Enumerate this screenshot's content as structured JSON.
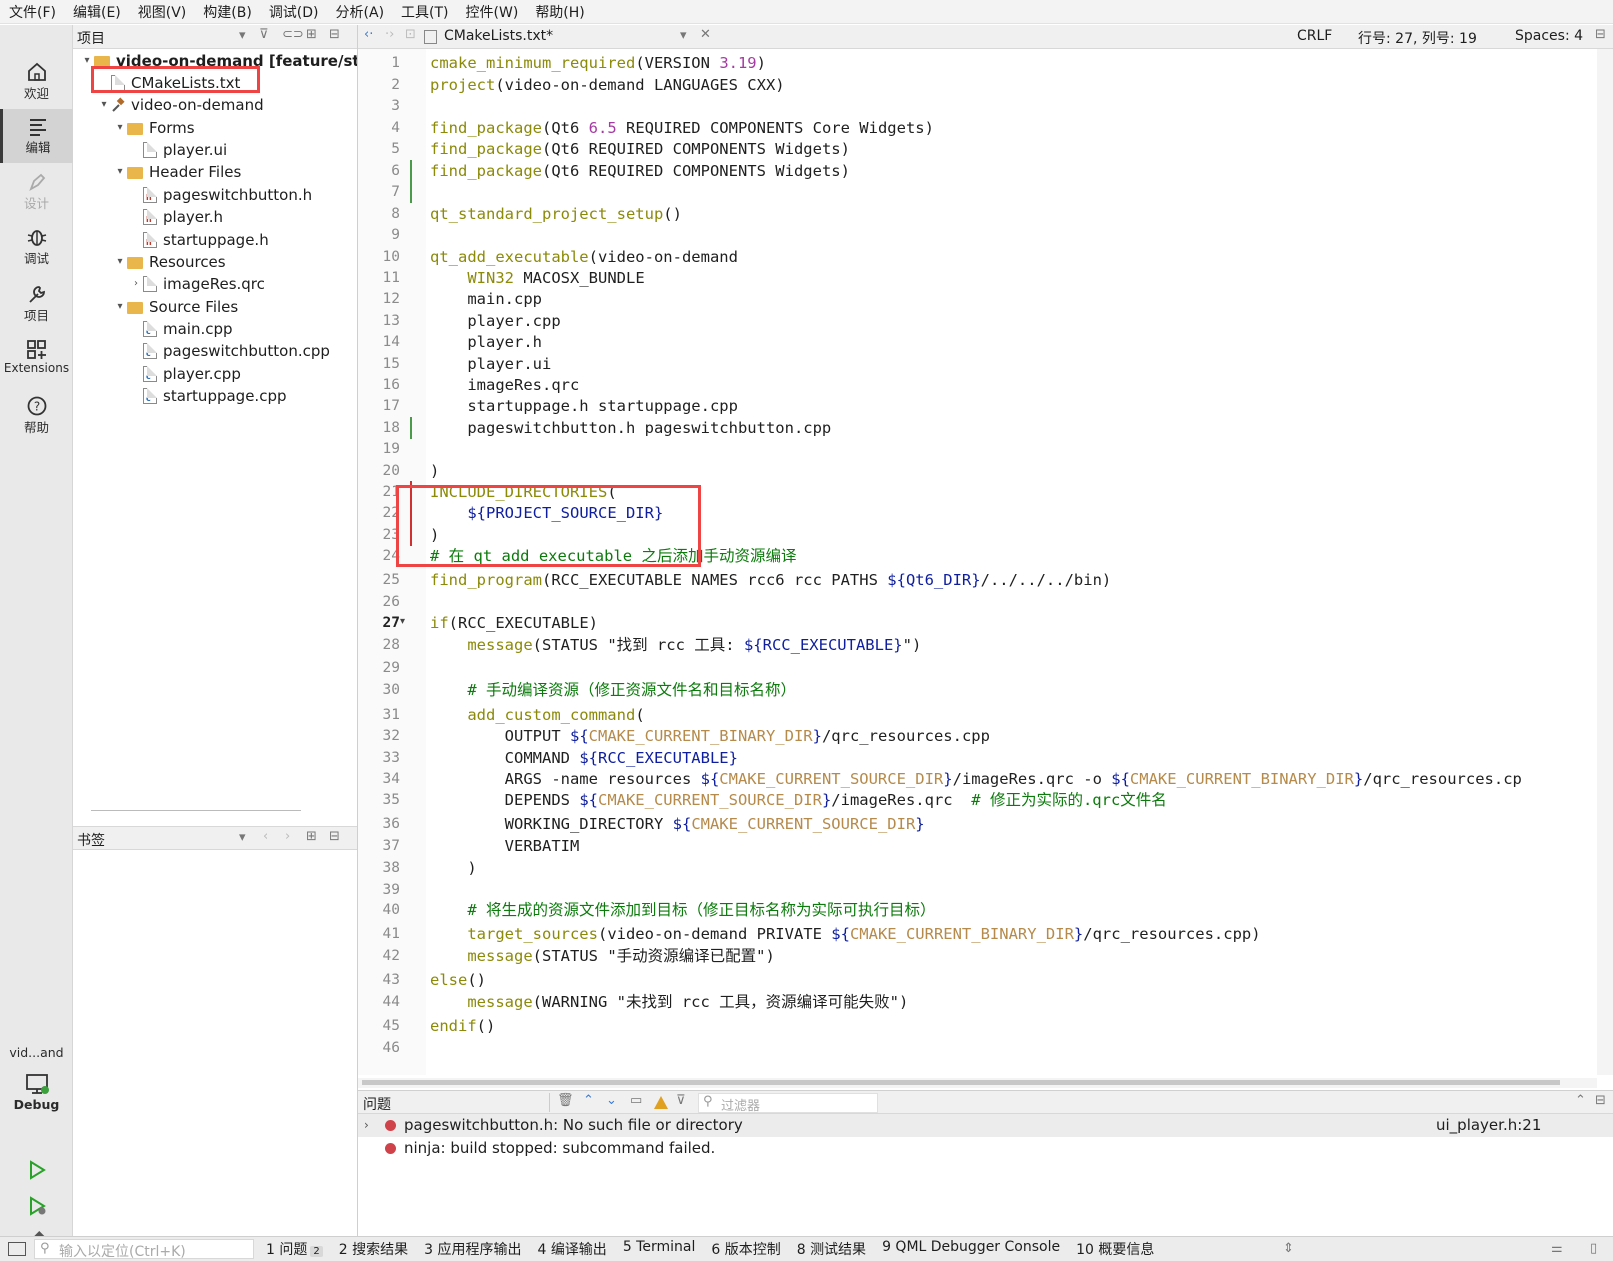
{
  "menu": [
    "文件(F)",
    "编辑(E)",
    "视图(V)",
    "构建(B)",
    "调试(D)",
    "分析(A)",
    "工具(T)",
    "控件(W)",
    "帮助(H)"
  ],
  "modes": [
    {
      "label": "欢迎",
      "icon": "home-icon"
    },
    {
      "label": "编辑",
      "icon": "edit-icon"
    },
    {
      "label": "设计",
      "icon": "design-icon"
    },
    {
      "label": "调试",
      "icon": "debug-icon"
    },
    {
      "label": "项目",
      "icon": "wrench-icon"
    },
    {
      "label": "Extensions",
      "icon": "extensions-icon"
    },
    {
      "label": "帮助",
      "icon": "help-icon"
    }
  ],
  "kit": {
    "project": "vid...and",
    "config": "Debug"
  },
  "project_panel": {
    "title": "项目"
  },
  "tree": [
    {
      "label": "video-on-demand [feature/start]",
      "kind": "root"
    },
    {
      "label": "CMakeLists.txt",
      "kind": "file"
    },
    {
      "label": "video-on-demand",
      "kind": "project"
    },
    {
      "label": "Forms",
      "kind": "folder"
    },
    {
      "label": "player.ui",
      "kind": "file"
    },
    {
      "label": "Header Files",
      "kind": "folder"
    },
    {
      "label": "pageswitchbutton.h",
      "kind": "header"
    },
    {
      "label": "player.h",
      "kind": "header"
    },
    {
      "label": "startuppage.h",
      "kind": "header"
    },
    {
      "label": "Resources",
      "kind": "folder"
    },
    {
      "label": "imageRes.qrc",
      "kind": "qrc"
    },
    {
      "label": "Source Files",
      "kind": "folder"
    },
    {
      "label": "main.cpp",
      "kind": "source"
    },
    {
      "label": "pageswitchbutton.cpp",
      "kind": "source"
    },
    {
      "label": "player.cpp",
      "kind": "source"
    },
    {
      "label": "startuppage.cpp",
      "kind": "source"
    }
  ],
  "bookmarks": {
    "title": "书签"
  },
  "editor": {
    "file_tab": "CMakeLists.txt*",
    "line_ending": "CRLF",
    "position": "行号: 27, 列号: 19",
    "indent": "Spaces: 4"
  },
  "code": [
    "cmake_minimum_required(VERSION 3.19)",
    "project(video-on-demand LANGUAGES CXX)",
    "",
    "find_package(Qt6 6.5 REQUIRED COMPONENTS Core Widgets)",
    "find_package(Qt6 REQUIRED COMPONENTS Widgets)",
    "find_package(Qt6 REQUIRED COMPONENTS Widgets)",
    "",
    "qt_standard_project_setup()",
    "",
    "qt_add_executable(video-on-demand",
    "    WIN32 MACOSX_BUNDLE",
    "    main.cpp",
    "    player.cpp",
    "    player.h",
    "    player.ui",
    "    imageRes.qrc",
    "    startuppage.h startuppage.cpp",
    "    pageswitchbutton.h pageswitchbutton.cpp",
    "",
    ")",
    "INCLUDE_DIRECTORIES(",
    "    ${PROJECT_SOURCE_DIR}",
    ")",
    "# 在 qt_add_executable 之后添加手动资源编译",
    "find_program(RCC_EXECUTABLE NAMES rcc6 rcc PATHS ${Qt6_DIR}/../../../bin)",
    "",
    "if(RCC_EXECUTABLE)",
    "    message(STATUS \"找到 rcc 工具: ${RCC_EXECUTABLE}\")",
    "",
    "    # 手动编译资源（修正资源文件名和目标名称）",
    "    add_custom_command(",
    "        OUTPUT ${CMAKE_CURRENT_BINARY_DIR}/qrc_resources.cpp",
    "        COMMAND ${RCC_EXECUTABLE}",
    "        ARGS -name resources ${CMAKE_CURRENT_SOURCE_DIR}/imageRes.qrc -o ${CMAKE_CURRENT_BINARY_DIR}/qrc_resources.cp",
    "        DEPENDS ${CMAKE_CURRENT_SOURCE_DIR}/imageRes.qrc  # 修正为实际的.qrc文件名",
    "        WORKING_DIRECTORY ${CMAKE_CURRENT_SOURCE_DIR}",
    "        VERBATIM",
    "    )",
    "",
    "    # 将生成的资源文件添加到目标（修正目标名称为实际可执行目标）",
    "    target_sources(video-on-demand PRIVATE ${CMAKE_CURRENT_BINARY_DIR}/qrc_resources.cpp)",
    "    message(STATUS \"手动资源编译已配置\")",
    "else()",
    "    message(WARNING \"未找到 rcc 工具，资源编译可能失败\")",
    "endif()",
    ""
  ],
  "issues": {
    "title": "问题",
    "filter_placeholder": "过滤器",
    "items": [
      {
        "text": "pageswitchbutton.h: No such file or directory",
        "location": "ui_player.h:21"
      },
      {
        "text": "ninja: build stopped: subcommand failed.",
        "location": ""
      }
    ]
  },
  "statusbar": {
    "locator_placeholder": "输入以定位(Ctrl+K)",
    "tabs": [
      {
        "num": "1",
        "label": "问题",
        "badge": "2"
      },
      {
        "num": "2",
        "label": "搜索结果"
      },
      {
        "num": "3",
        "label": "应用程序输出"
      },
      {
        "num": "4",
        "label": "编译输出"
      },
      {
        "num": "5",
        "label": "Terminal"
      },
      {
        "num": "6",
        "label": "版本控制"
      },
      {
        "num": "8",
        "label": "测试结果"
      },
      {
        "num": "9",
        "label": "QML Debugger Console"
      },
      {
        "num": "10",
        "label": "概要信息"
      }
    ]
  },
  "colors": {
    "annotation": "#ef4444",
    "keyword": "#8b8a09",
    "variable": "#0e1e9e",
    "comment": "#0b7b0b",
    "number": "#a53aa2",
    "error": "#d0424a"
  }
}
